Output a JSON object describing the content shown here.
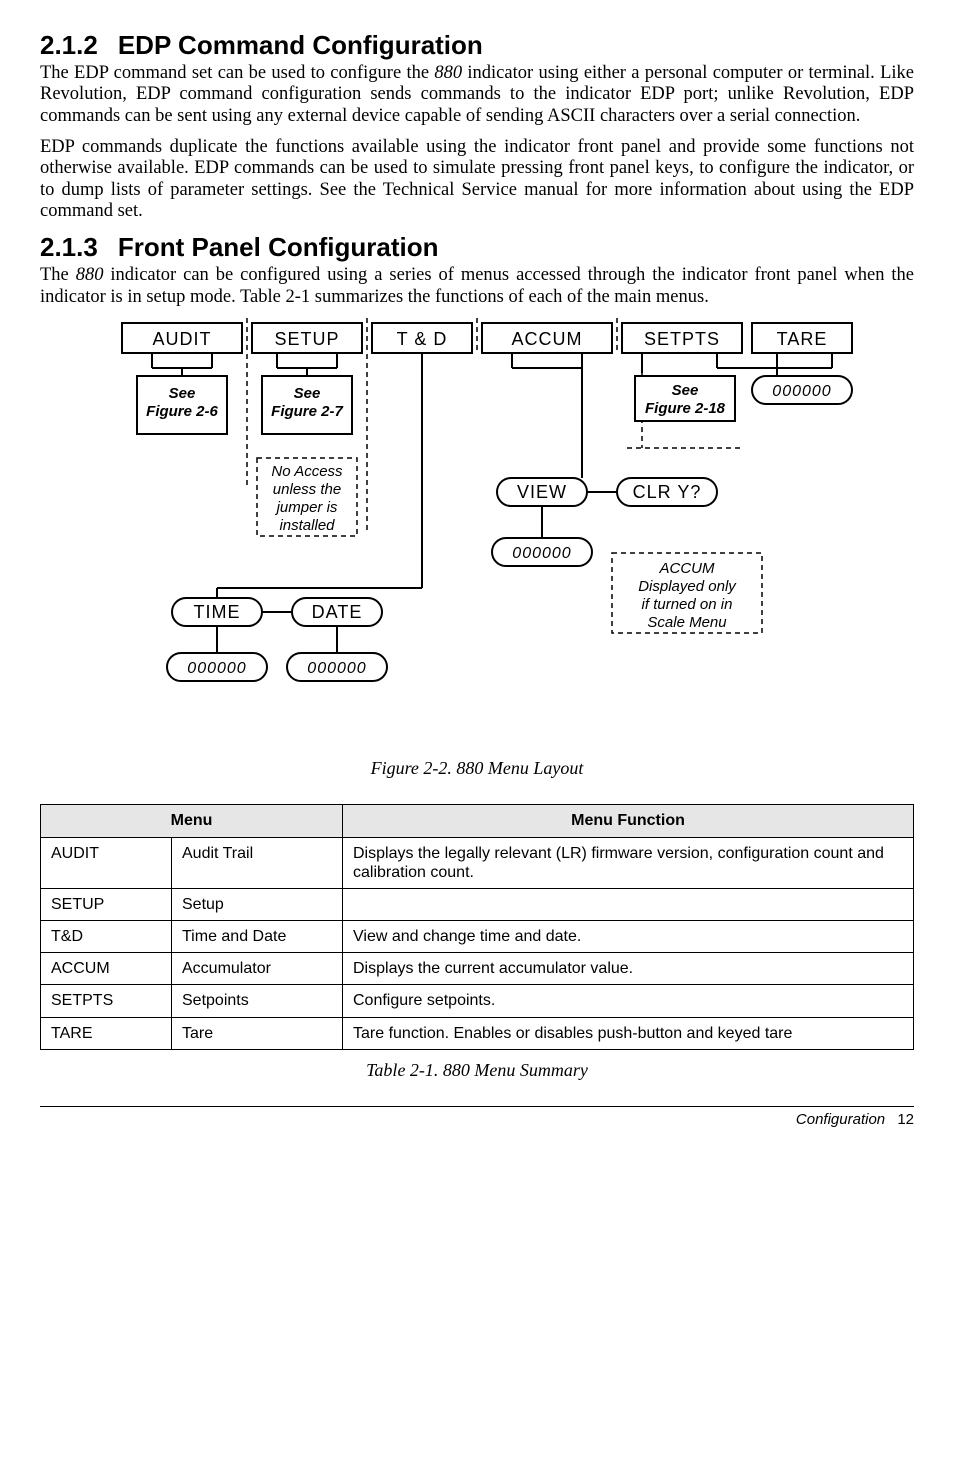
{
  "sec212": {
    "num": "2.1.2",
    "title": "EDP Command Configuration",
    "p1_pre": "The EDP command set can be used to configure the ",
    "p1_em": "880",
    "p1_post": " indicator using either a personal computer or terminal. Like Revolution, EDP command configuration sends commands to the indicator EDP port; unlike Revolution, EDP commands can be sent using any external device capable of sending ASCII characters over a serial connection.",
    "p2": "EDP commands duplicate the functions available using the indicator front panel and provide some functions not otherwise available. EDP commands can be used to simulate pressing front panel keys, to configure the indicator, or to dump lists of parameter settings. See the Technical Service manual for more information about using the EDP command set."
  },
  "sec213": {
    "num": "2.1.3",
    "title": "Front Panel Configuration",
    "p1_pre": "The ",
    "p1_em": "880",
    "p1_post": " indicator can be configured using a series of menus accessed through the indicator front panel when the indicator is in setup mode. Table 2-1 summarizes the functions of each of the main menus."
  },
  "diagram": {
    "top": [
      "AUDIT",
      "SETUP",
      "T & D",
      "ACCUM",
      "SETPTS",
      "TARE"
    ],
    "see26_l1": "See",
    "see26_l2": "Figure 2-6",
    "see27_l1": "See",
    "see27_l2": "Figure 2-7",
    "see218_l1": "See",
    "see218_l2": "Figure 2-18",
    "noaccess_l1": "No Access",
    "noaccess_l2": "unless the",
    "noaccess_l3": "jumper is",
    "noaccess_l4": "installed",
    "view": "VIEW",
    "clr": "CLR Y?",
    "zeros": "000000",
    "accum_note_l1": "ACCUM",
    "accum_note_l2": "Displayed only",
    "accum_note_l3": "if turned on in",
    "accum_note_l4": "Scale Menu",
    "time": "TIME",
    "date": "DATE",
    "caption": "Figure 2-2. 880 Menu Layout"
  },
  "table": {
    "head_menu": "Menu",
    "head_func": "Menu Function",
    "rows": [
      {
        "c1": "AUDIT",
        "c2": "Audit Trail",
        "c3": "Displays the legally relevant (LR) firmware version, configuration count and calibration count."
      },
      {
        "c1": "SETUP",
        "c2": "Setup",
        "c3": ""
      },
      {
        "c1": "T&D",
        "c2": "Time and Date",
        "c3": "View and change time and date."
      },
      {
        "c1": "ACCUM",
        "c2": "Accumulator",
        "c3": "Displays the current accumulator value."
      },
      {
        "c1": "SETPTS",
        "c2": "Setpoints",
        "c3": "Configure setpoints."
      },
      {
        "c1": "TARE",
        "c2": "Tare",
        "c3": "Tare function. Enables or disables push-button and keyed tare"
      }
    ],
    "caption": "Table 2-1. 880 Menu Summary"
  },
  "footer": {
    "section": "Configuration",
    "page": "12"
  }
}
